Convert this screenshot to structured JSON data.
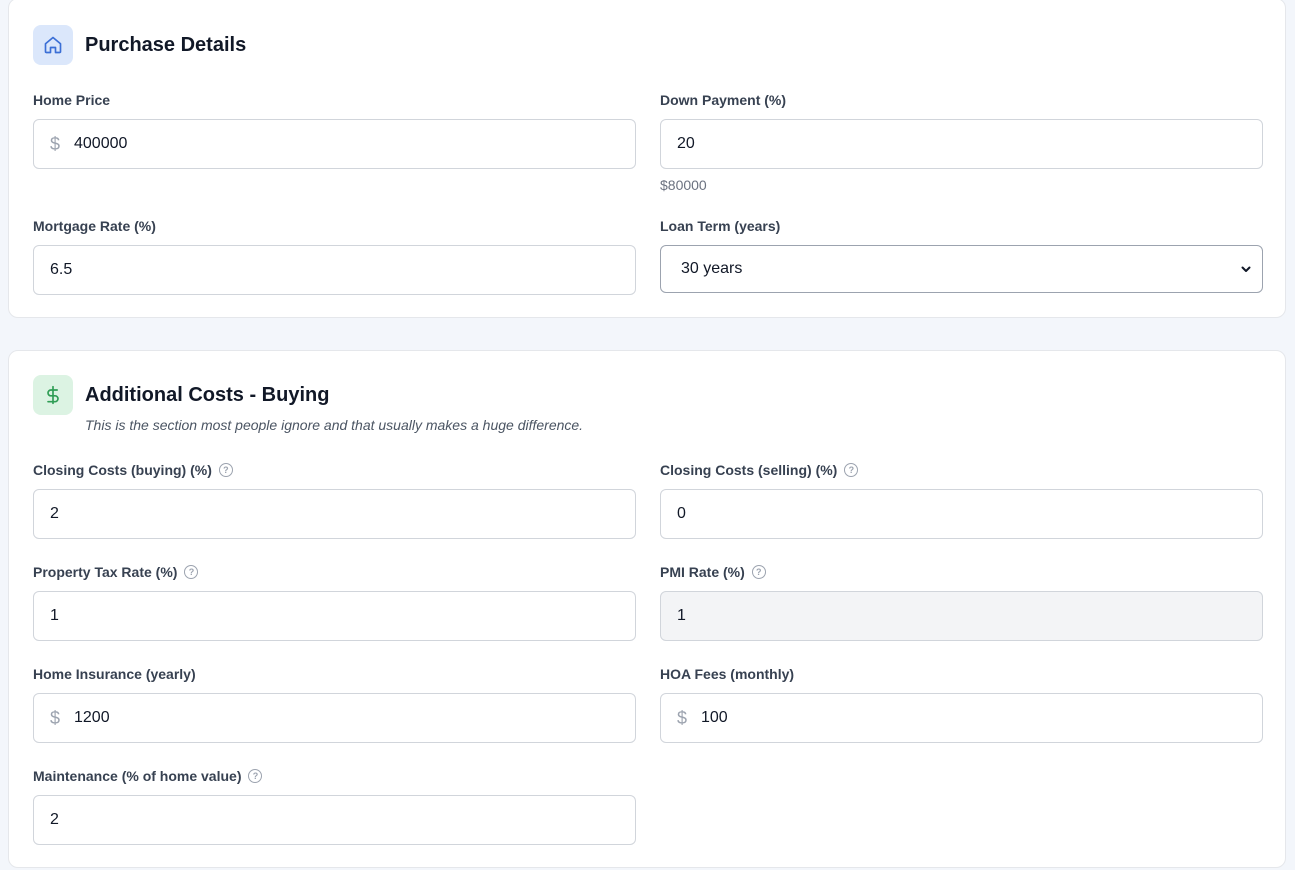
{
  "purchase": {
    "title": "Purchase Details",
    "icon": "home-icon",
    "home_price": {
      "label": "Home Price",
      "value": "400000",
      "prefix": "$"
    },
    "down_payment": {
      "label": "Down Payment (%)",
      "value": "20",
      "note": "$80000"
    },
    "mortgage_rate": {
      "label": "Mortgage Rate (%)",
      "value": "6.5"
    },
    "loan_term": {
      "label": "Loan Term (years)",
      "selected": "30 years"
    }
  },
  "additional": {
    "title": "Additional Costs - Buying",
    "icon": "dollar-icon",
    "subtitle": "This is the section most people ignore and that usually makes a huge difference.",
    "closing_buy": {
      "label": "Closing Costs (buying) (%)",
      "value": "2"
    },
    "closing_sell": {
      "label": "Closing Costs (selling) (%)",
      "value": "0"
    },
    "property_tax": {
      "label": "Property Tax Rate (%)",
      "value": "1"
    },
    "pmi_rate": {
      "label": "PMI Rate (%)",
      "value": "1"
    },
    "home_insurance": {
      "label": "Home Insurance (yearly)",
      "value": "1200",
      "prefix": "$"
    },
    "hoa_fees": {
      "label": "HOA Fees (monthly)",
      "value": "100",
      "prefix": "$"
    },
    "maintenance": {
      "label": "Maintenance (% of home value)",
      "value": "2"
    }
  },
  "help_glyph": "?",
  "colors": {
    "accent_blue": "#3b6fd6",
    "accent_green": "#2f9d55",
    "page_bg": "#f3f6fb"
  }
}
